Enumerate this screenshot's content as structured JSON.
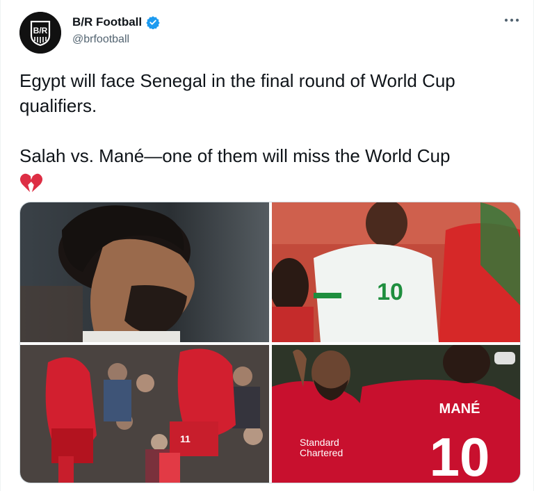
{
  "account": {
    "display_name": "B/R Football",
    "handle": "@brfootball",
    "avatar_logo_text": "B/R",
    "verified": true
  },
  "tweet": {
    "line1": "Egypt will face Senegal in the final round of World Cup qualifiers.",
    "line2": "Salah vs. Mané—one of them will miss the World Cup",
    "emoji": "broken-heart-icon"
  },
  "media": {
    "jersey_name": "MANÉ",
    "jersey_number": "10",
    "sponsor_line1": "Standard",
    "sponsor_line2": "Chartered",
    "senegal_number": "10",
    "salah_number": "11"
  },
  "colors": {
    "liverpool_red": "#c8102e",
    "brand_dark": "#0f1419",
    "verified_blue": "#1d9bf0",
    "muted": "#536471"
  }
}
